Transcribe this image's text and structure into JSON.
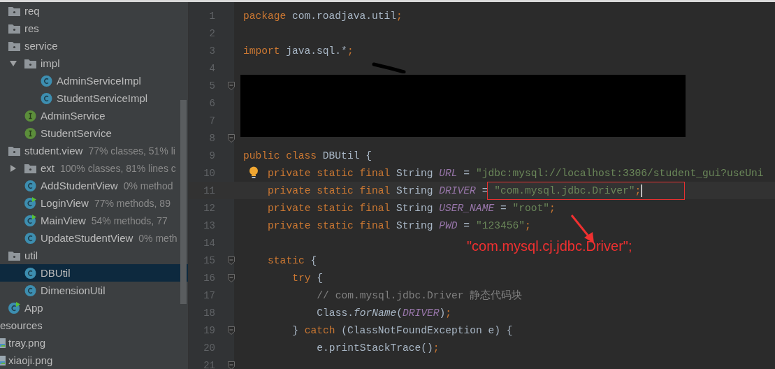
{
  "tree": [
    {
      "label": "req",
      "kind": "folder",
      "selected": false
    },
    {
      "label": "res",
      "kind": "folder",
      "selected": false
    },
    {
      "label": "service",
      "kind": "folder",
      "selected": false,
      "children": [
        {
          "label": "impl",
          "kind": "folder",
          "selected": false,
          "expanded": true,
          "children": [
            {
              "label": "AdminServiceImpl",
              "kind": "class",
              "selected": false
            },
            {
              "label": "StudentServiceImpl",
              "kind": "class",
              "selected": false
            }
          ]
        },
        {
          "label": "AdminService",
          "kind": "interface",
          "selected": false
        },
        {
          "label": "StudentService",
          "kind": "interface",
          "selected": false
        }
      ]
    },
    {
      "label": "student.view",
      "kind": "folder",
      "selected": false,
      "coverage": "77% classes, 51% li",
      "children": [
        {
          "label": "ext",
          "kind": "folder",
          "selected": false,
          "expanded": false,
          "coverage": "100% classes, 81% lines c"
        },
        {
          "label": "AddStudentView",
          "kind": "class",
          "selected": false,
          "coverage": "0% method"
        },
        {
          "label": "LoginView",
          "kind": "runnable",
          "selected": false,
          "coverage": "77% methods, 89"
        },
        {
          "label": "MainView",
          "kind": "runnable",
          "selected": false,
          "coverage": "54% methods, 77"
        },
        {
          "label": "UpdateStudentView",
          "kind": "class",
          "selected": false,
          "coverage": "0% meth"
        }
      ]
    },
    {
      "label": "util",
      "kind": "folder",
      "selected": false,
      "children": [
        {
          "label": "DBUtil",
          "kind": "class",
          "selected": true
        },
        {
          "label": "DimensionUtil",
          "kind": "class",
          "selected": false
        }
      ]
    },
    {
      "label": "App",
      "kind": "runnable",
      "selected": false
    }
  ],
  "outer_tree": [
    {
      "label": "esources",
      "selected": false,
      "children": [
        {
          "label": "tray.png",
          "kind": "image",
          "selected": false
        },
        {
          "label": "xiaoji.png",
          "kind": "image",
          "selected": false
        }
      ]
    }
  ],
  "editor": {
    "lines": [
      {
        "number": "1",
        "tokens": [
          {
            "text": "package",
            "kind": "kw"
          },
          {
            "text": " com.roadjava.util",
            "kind": "plain"
          },
          {
            "text": ";",
            "kind": "kw"
          }
        ]
      },
      {
        "number": "2"
      },
      {
        "number": "3",
        "tokens": [
          {
            "text": "import",
            "kind": "kw"
          },
          {
            "text": " java.sql.*",
            "kind": "plain"
          },
          {
            "text": ";",
            "kind": "kw"
          }
        ]
      },
      {
        "number": "4"
      },
      {
        "number": "5",
        "fold": true
      },
      {
        "number": "6"
      },
      {
        "number": "7"
      },
      {
        "number": "8",
        "fold": true
      },
      {
        "number": "9",
        "tokens": [
          {
            "text": "public class",
            "kind": "kw"
          },
          {
            "text": " DBUtil {",
            "kind": "plain"
          }
        ]
      },
      {
        "number": "10",
        "bulb": true,
        "tokens": [
          {
            "text": "    private static final",
            "kind": "kw"
          },
          {
            "text": " String ",
            "kind": "plain"
          },
          {
            "text": "URL",
            "kind": "const"
          },
          {
            "text": " = ",
            "kind": "plain"
          },
          {
            "text": "\"jdbc:mysql://localhost:3306/student_gui?useUni",
            "kind": "str"
          }
        ]
      },
      {
        "number": "11",
        "current": true,
        "tokens": [
          {
            "text": "    private static final",
            "kind": "kw"
          },
          {
            "text": " String ",
            "kind": "plain"
          },
          {
            "text": "DRIVER",
            "kind": "const"
          },
          {
            "text": " = ",
            "kind": "plain"
          },
          {
            "text": "\"com.mysql.jdbc.Driver\"",
            "kind": "str"
          },
          {
            "text": ";",
            "kind": "kw"
          }
        ]
      },
      {
        "number": "12",
        "tokens": [
          {
            "text": "    private static final",
            "kind": "kw"
          },
          {
            "text": " String ",
            "kind": "plain"
          },
          {
            "text": "USER_NAME",
            "kind": "const"
          },
          {
            "text": " = ",
            "kind": "plain"
          },
          {
            "text": "\"root\"",
            "kind": "str"
          },
          {
            "text": ";",
            "kind": "kw"
          }
        ]
      },
      {
        "number": "13",
        "tokens": [
          {
            "text": "    private static final",
            "kind": "kw"
          },
          {
            "text": " String ",
            "kind": "plain"
          },
          {
            "text": "PWD",
            "kind": "const"
          },
          {
            "text": " = ",
            "kind": "plain"
          },
          {
            "text": "\"123456\"",
            "kind": "str"
          },
          {
            "text": ";",
            "kind": "kw"
          }
        ]
      },
      {
        "number": "14"
      },
      {
        "number": "15",
        "fold": true,
        "tokens": [
          {
            "text": "    static",
            "kind": "kw"
          },
          {
            "text": " {",
            "kind": "plain"
          }
        ]
      },
      {
        "number": "16",
        "fold": true,
        "tokens": [
          {
            "text": "        try",
            "kind": "kw"
          },
          {
            "text": " {",
            "kind": "plain"
          }
        ]
      },
      {
        "number": "17",
        "tokens": [
          {
            "text": "            // com.mysql.jdbc.Driver 静态代码块",
            "kind": "comment"
          }
        ]
      },
      {
        "number": "18",
        "tokens": [
          {
            "text": "            Class.",
            "kind": "plain"
          },
          {
            "text": "forName",
            "kind": "method"
          },
          {
            "text": "(",
            "kind": "plain"
          },
          {
            "text": "DRIVER",
            "kind": "const"
          },
          {
            "text": ")",
            "kind": "plain"
          },
          {
            "text": ";",
            "kind": "kw"
          }
        ]
      },
      {
        "number": "19",
        "fold": true,
        "tokens": [
          {
            "text": "        } ",
            "kind": "plain"
          },
          {
            "text": "catch",
            "kind": "kw"
          },
          {
            "text": " (ClassNotFoundException e) {",
            "kind": "plain"
          }
        ]
      },
      {
        "number": "20",
        "tokens": [
          {
            "text": "            e.printStackTrace()",
            "kind": "plain"
          },
          {
            "text": ";",
            "kind": "kw"
          }
        ]
      },
      {
        "number": "21",
        "fold": true
      }
    ]
  },
  "annotation": {
    "text": "\"com.mysql.cj.jdbc.Driver\";"
  }
}
